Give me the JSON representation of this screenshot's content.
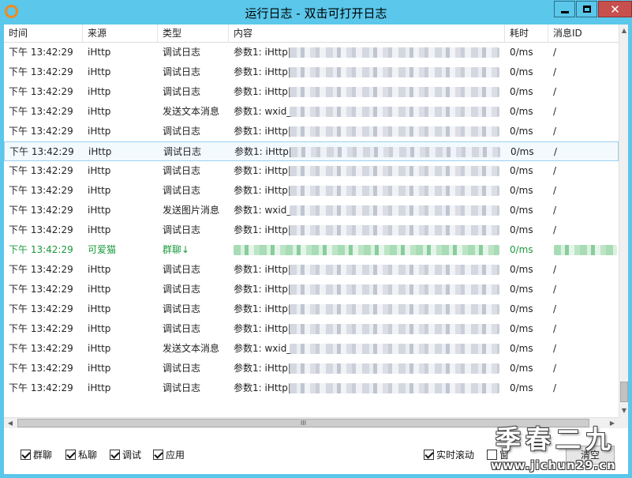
{
  "window": {
    "title": "运行日志 - 双击可打开日志",
    "min_symbol": "",
    "max_symbol": "",
    "close_symbol": "✕"
  },
  "table": {
    "columns": [
      "时间",
      "来源",
      "类型",
      "内容",
      "耗时",
      "消息ID"
    ],
    "rows": [
      {
        "time": "下午 13:42:29",
        "source": "iHttp",
        "type": "调试日志",
        "content": "参数1: iHttp|",
        "cost": "0/ms",
        "msgid": "/"
      },
      {
        "time": "下午 13:42:29",
        "source": "iHttp",
        "type": "调试日志",
        "content": "参数1: iHttp|",
        "cost": "0/ms",
        "msgid": "/"
      },
      {
        "time": "下午 13:42:29",
        "source": "iHttp",
        "type": "调试日志",
        "content": "参数1: iHttp|",
        "cost": "0/ms",
        "msgid": "/"
      },
      {
        "time": "下午 13:42:29",
        "source": "iHttp",
        "type": "发送文本消息",
        "content": "参数1: wxid_",
        "cost": "0/ms",
        "msgid": "/"
      },
      {
        "time": "下午 13:42:29",
        "source": "iHttp",
        "type": "调试日志",
        "content": "参数1: iHttp|",
        "cost": "0/ms",
        "msgid": "/"
      },
      {
        "time": "下午 13:42:29",
        "source": "iHttp",
        "type": "调试日志",
        "content": "参数1: iHttp|",
        "cost": "0/ms",
        "msgid": "/"
      },
      {
        "time": "下午 13:42:29",
        "source": "iHttp",
        "type": "调试日志",
        "content": "参数1: iHttp|",
        "cost": "0/ms",
        "msgid": "/"
      },
      {
        "time": "下午 13:42:29",
        "source": "iHttp",
        "type": "调试日志",
        "content": "参数1: iHttp|",
        "cost": "0/ms",
        "msgid": "/"
      },
      {
        "time": "下午 13:42:29",
        "source": "iHttp",
        "type": "发送图片消息",
        "content": "参数1: wxid_",
        "cost": "0/ms",
        "msgid": "/"
      },
      {
        "time": "下午 13:42:29",
        "source": "iHttp",
        "type": "调试日志",
        "content": "参数1: iHttp|",
        "cost": "0/ms",
        "msgid": "/"
      },
      {
        "time": "下午 13:42:29",
        "source": "可爱猫",
        "type": "群聊↓",
        "content": "",
        "cost": "0/ms",
        "msgid": ""
      },
      {
        "time": "下午 13:42:29",
        "source": "iHttp",
        "type": "调试日志",
        "content": "参数1: iHttp|",
        "cost": "0/ms",
        "msgid": "/"
      },
      {
        "time": "下午 13:42:29",
        "source": "iHttp",
        "type": "调试日志",
        "content": "参数1: iHttp|",
        "cost": "0/ms",
        "msgid": "/"
      },
      {
        "time": "下午 13:42:29",
        "source": "iHttp",
        "type": "调试日志",
        "content": "参数1: iHttp|",
        "cost": "0/ms",
        "msgid": "/"
      },
      {
        "time": "下午 13:42:29",
        "source": "iHttp",
        "type": "调试日志",
        "content": "参数1: iHttp|",
        "cost": "0/ms",
        "msgid": "/"
      },
      {
        "time": "下午 13:42:29",
        "source": "iHttp",
        "type": "发送文本消息",
        "content": "参数1: wxid_",
        "cost": "0/ms",
        "msgid": "/"
      },
      {
        "time": "下午 13:42:29",
        "source": "iHttp",
        "type": "调试日志",
        "content": "参数1: iHttp|",
        "cost": "0/ms",
        "msgid": "/"
      },
      {
        "time": "下午 13:42:29",
        "source": "iHttp",
        "type": "调试日志",
        "content": "参数1: iHttp|",
        "cost": "0/ms",
        "msgid": "/"
      }
    ],
    "selected_row": 5,
    "highlight_row": 10,
    "highlight_color": "#1a9a3c"
  },
  "scrollbars": {
    "up": "▲",
    "down": "▼",
    "left": "◀",
    "right": "▶",
    "grip": "III"
  },
  "footer": {
    "filters": [
      {
        "label": "群聊",
        "checked": true
      },
      {
        "label": "私聊",
        "checked": true
      },
      {
        "label": "调试",
        "checked": true
      },
      {
        "label": "应用",
        "checked": true
      }
    ],
    "realtime_scroll": {
      "label": "实时滚动",
      "checked": true
    },
    "option2": {
      "label": "窗",
      "checked": false
    },
    "clear_label": "清空"
  },
  "watermark": {
    "big": "季春二九",
    "small": "www.jichun29.cn"
  },
  "colors": {
    "titlebar": "#5bc7ea",
    "close_button": "#c7504f",
    "app_icon": "#f08a1c"
  }
}
